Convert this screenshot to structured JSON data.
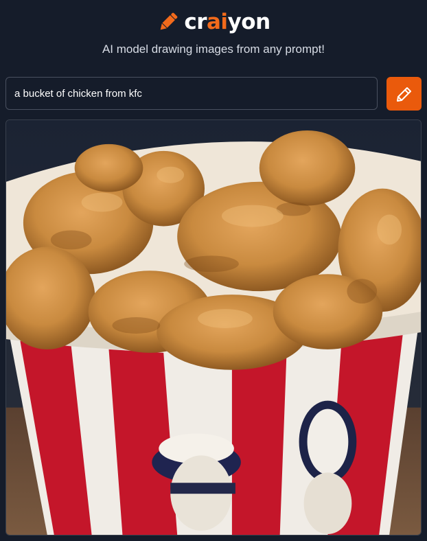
{
  "brand": {
    "name_before": "cr",
    "name_accent": "ai",
    "name_after": "yon",
    "logo_icon": "pencil-icon",
    "accent_color": "#f26a1b"
  },
  "tagline": "AI model drawing images from any prompt!",
  "prompt": {
    "value": "a bucket of chicken from kfc",
    "placeholder": ""
  },
  "draw_button": {
    "icon": "pencil-icon",
    "color": "#ea5a0c"
  },
  "result": {
    "alt": "a bucket of chicken from kfc"
  },
  "colors": {
    "background": "#151c2a",
    "input_border": "#4a5160"
  }
}
